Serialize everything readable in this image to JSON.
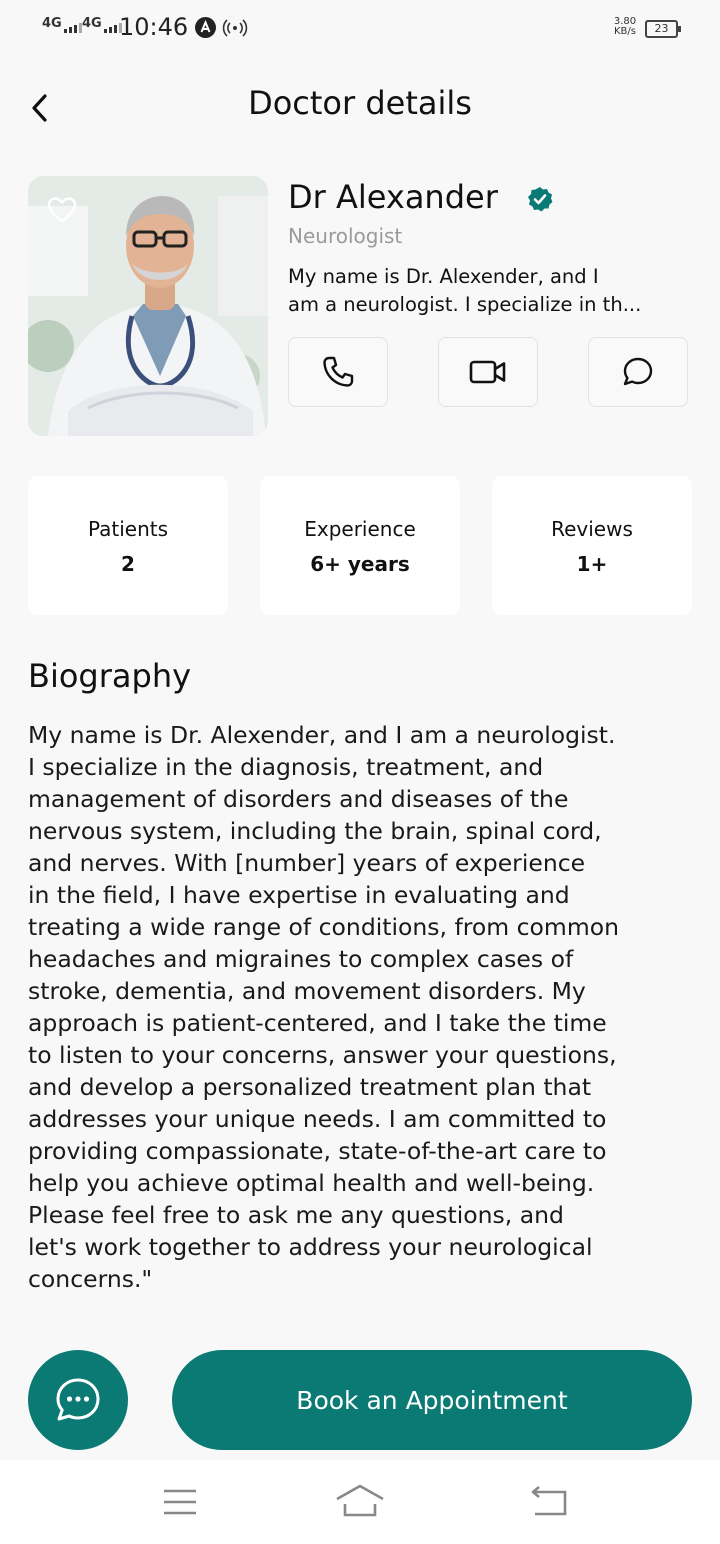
{
  "status": {
    "network1": "4G",
    "network2": "4G",
    "time": "10:46",
    "speed_value": "3.80",
    "speed_unit": "KB/s",
    "battery": "23"
  },
  "header": {
    "title": "Doctor details"
  },
  "doctor": {
    "name": "Dr Alexander",
    "specialty": "Neurologist",
    "summary_line1": "My name is Dr. Alexender, and I",
    "summary_line2": "am a neurologist. I specialize in th..."
  },
  "stats": [
    {
      "label": "Patients",
      "value": "2"
    },
    {
      "label": "Experience",
      "value": "6+ years"
    },
    {
      "label": "Reviews",
      "value": "1+"
    }
  ],
  "biography": {
    "title": "Biography",
    "lines": [
      "My name is Dr. Alexender, and I am a neurologist.",
      "I specialize in the diagnosis, treatment, and",
      "management of disorders and diseases of the",
      "nervous system, including the brain, spinal cord,",
      "and nerves. With [number] years of experience",
      "in the field, I have expertise in evaluating and",
      "treating a wide range of conditions, from common",
      "headaches and migraines to complex cases of",
      "stroke, dementia, and movement disorders. My",
      "approach is patient-centered, and I take the time",
      "to listen to your concerns, answer your questions,",
      "and develop a personalized treatment plan that",
      "addresses your unique needs. I am committed to",
      "providing compassionate, state-of-the-art care to",
      "help you achieve optimal health and well-being.",
      "Please feel free to ask me any questions, and",
      "let's work together to address your neurological",
      "concerns.\""
    ]
  },
  "actions": {
    "book_label": "Book an Appointment"
  },
  "icons": {
    "back": "chevron-left-icon",
    "favorite": "heart-outline-icon",
    "verified": "verified-badge-icon",
    "call": "phone-icon",
    "video": "video-camera-icon",
    "message": "chat-bubble-icon",
    "chat_fab": "chat-dots-icon",
    "nav_menu": "menu-icon",
    "nav_home": "home-icon",
    "nav_back": "back-icon"
  },
  "colors": {
    "primary": "#0b7a75",
    "background": "#f8f8f8",
    "card": "#ffffff",
    "muted_text": "#9a9a9a"
  }
}
